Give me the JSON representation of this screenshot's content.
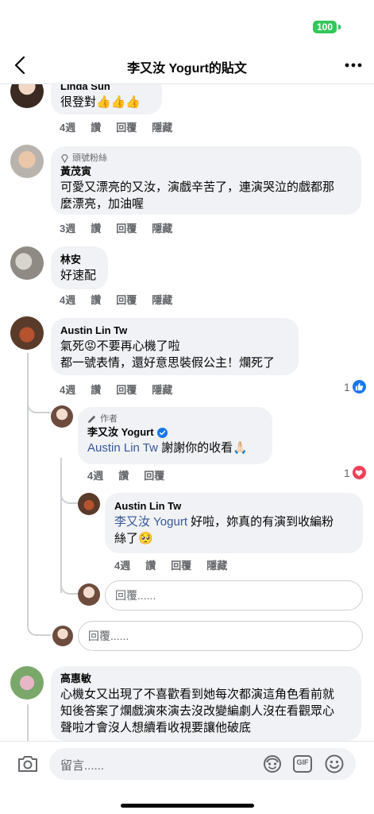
{
  "status": {
    "battery": "100"
  },
  "header": {
    "title": "李又汝 Yogurt的貼文"
  },
  "comments": [
    {
      "name": "Linda Sun",
      "text": "很登對👍👍👍",
      "time": "4週",
      "like": "讚",
      "reply": "回覆",
      "hide": "隱藏"
    },
    {
      "badge": "頭號粉絲",
      "name": "黃茂寅",
      "text_line1": "可愛又漂亮的又汝，演戲辛苦了，連演哭泣的戲都那",
      "text_line2": "麼漂亮，加油喔",
      "time": "3週",
      "like": "讚",
      "reply": "回覆",
      "hide": "隱藏"
    },
    {
      "name": "林安",
      "text": "好速配",
      "time": "4週",
      "like": "讚",
      "reply": "回覆",
      "hide": "隱藏"
    },
    {
      "name": "Austin Lin Tw",
      "text_line1": "氣死😡不要再心機了啦",
      "text_line2": "都一號表情，還好意思裝假公主！爛死了",
      "time": "4週",
      "like": "讚",
      "reply": "回覆",
      "hide": "隱藏",
      "reactions": "1"
    },
    {
      "badge": "作者",
      "name": "李又汝 Yogurt",
      "mention": "Austin Lin Tw",
      "text": " 謝謝你的收看🙏🏻",
      "time": "4週",
      "like": "讚",
      "reply": "回覆",
      "reactions": "1"
    },
    {
      "name": "Austin Lin Tw",
      "mention": "李又汝 Yogurt",
      "text_line1": " 好啦，妳真的有演到收編粉",
      "text_line2": "絲了🥺",
      "time": "4週",
      "like": "讚",
      "reply": "回覆",
      "hide": "隱藏"
    },
    {
      "name": "高惠敏",
      "text_line1": "心機女又出現了不喜歡看到她每次都演這角色看前就",
      "text_line2": "知後答案了爛戲演來演去沒改變編劇人沒在看觀眾心",
      "text_line3": "聲啦才會沒人想續看收視要讓他破底"
    }
  ],
  "reply_placeholder_inner": "回覆......",
  "reply_placeholder_outer": "回覆......",
  "composer": {
    "placeholder": "留言......",
    "gif": "GIF"
  },
  "colors": {
    "like_blue": "#1877f2",
    "heart_red": "#f33e58",
    "mention": "#385898",
    "verified": "#1877f2"
  }
}
